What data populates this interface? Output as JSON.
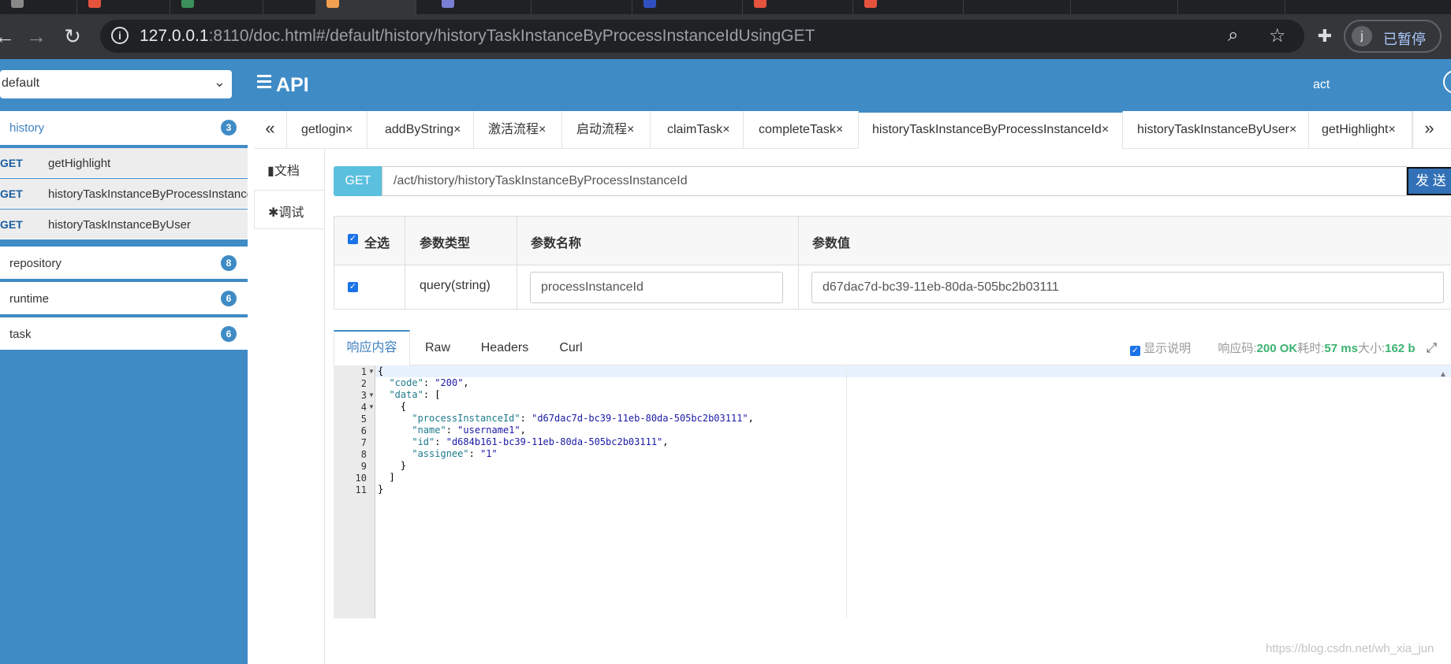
{
  "browser": {
    "url_host": "127.0.0.1",
    "url_path": ":8110/doc.html#/default/history/historyTaskInstanceByProcessInstanceIdUsingGET",
    "profile_initial": "j",
    "profile_label": "已暂停",
    "icons": [
      "back-icon",
      "forward-icon",
      "reload-icon",
      "info-icon",
      "zoom-icon",
      "star-icon",
      "extensions-icon"
    ]
  },
  "header": {
    "group_select": "default",
    "brand": "API",
    "user": "act"
  },
  "sidebar": {
    "groups": [
      {
        "name": "history",
        "count": "3"
      },
      {
        "name": "repository",
        "count": "8"
      },
      {
        "name": "runtime",
        "count": "6"
      },
      {
        "name": "task",
        "count": "6"
      }
    ],
    "history_items": [
      {
        "method": "GET",
        "path": "getHighlight"
      },
      {
        "method": "GET",
        "path": "historyTaskInstanceByProcessInstanceId"
      },
      {
        "method": "GET",
        "path": "historyTaskInstanceByUser"
      }
    ]
  },
  "api_tabs": {
    "prev": "«",
    "next": "»",
    "close": "×",
    "items": [
      "getlogin",
      "addByString",
      "激活流程",
      "启动流程",
      "claimTask",
      "completeTask",
      "historyTaskInstanceByProcessInstanceId",
      "historyTaskInstanceByUser",
      "getHighlight"
    ],
    "active_index": 6
  },
  "side_tabs": {
    "doc": "文档",
    "debug": "调试"
  },
  "request": {
    "method": "GET",
    "url": "/act/history/historyTaskInstanceByProcessInstanceId",
    "send": "发 送"
  },
  "params": {
    "headers": {
      "select_all": "全选",
      "type": "参数类型",
      "name": "参数名称",
      "value": "参数值"
    },
    "rows": [
      {
        "checked": true,
        "type": "query(string)",
        "name": "processInstanceId",
        "value": "d67dac7d-bc39-11eb-80da-505bc2b03111"
      }
    ]
  },
  "response": {
    "tabs": [
      "响应内容",
      "Raw",
      "Headers",
      "Curl"
    ],
    "show_desc": "显示说明",
    "code_label": "响应码:",
    "code_value": "200 OK",
    "time_label": "耗时:",
    "time_value": "57 ms",
    "size_label": "大小:",
    "size_value": "162 b",
    "body": {
      "code": "200",
      "processInstanceId": "d67dac7d-bc39-11eb-80da-505bc2b03111",
      "name": "username1",
      "id": "d684b161-bc39-11eb-80da-505bc2b03111",
      "assignee": "1"
    },
    "line_numbers": [
      "1",
      "2",
      "3",
      "4",
      "5",
      "6",
      "7",
      "8",
      "9",
      "10",
      "11"
    ]
  },
  "watermark": "https://blog.csdn.net/wh_xia_jun"
}
